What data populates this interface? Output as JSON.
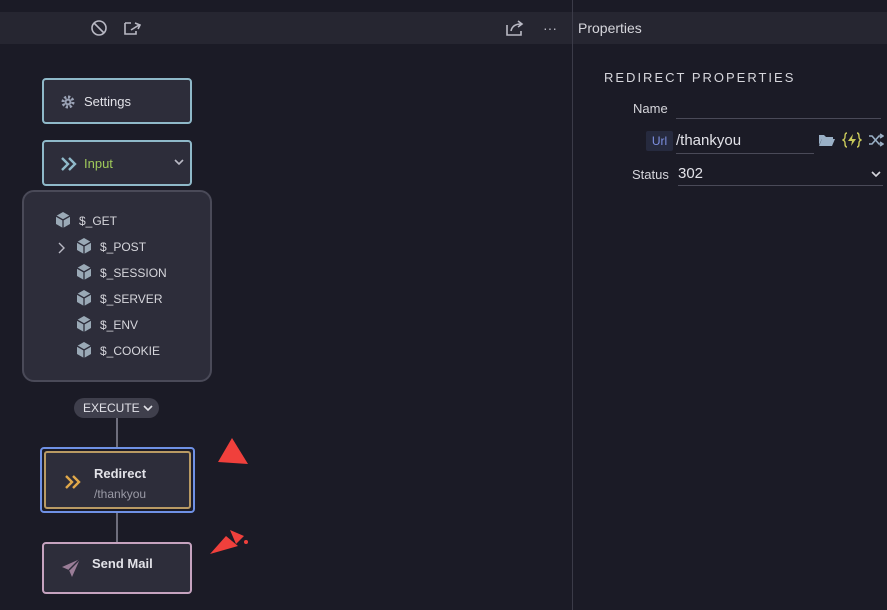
{
  "toolbar": {
    "actions": [
      "disable-icon",
      "export-icon",
      "share-icon",
      "more-icon"
    ],
    "more_label": "···"
  },
  "flow": {
    "settings_node": {
      "label": "Settings"
    },
    "input_node": {
      "label": "Input"
    },
    "input_vars": [
      "$_GET",
      "$_POST",
      "$_SESSION",
      "$_SERVER",
      "$_ENV",
      "$_COOKIE"
    ],
    "execute_label": "EXECUTE",
    "redirect_node": {
      "title": "Redirect",
      "subtitle": "/thankyou"
    },
    "sendmail_node": {
      "title": "Send Mail"
    }
  },
  "properties": {
    "header": "Properties",
    "title": "REDIRECT PROPERTIES",
    "name_label": "Name",
    "name_value": "",
    "url_chip": "Url",
    "url_value": "/thankyou",
    "status_label": "Status",
    "status_value": "302"
  },
  "colors": {
    "annotation_arrow": "#f0403c",
    "input_accent": "#9fc95a",
    "redirect_accent": "#e0a84a",
    "mail_accent": "#9a7d97"
  }
}
